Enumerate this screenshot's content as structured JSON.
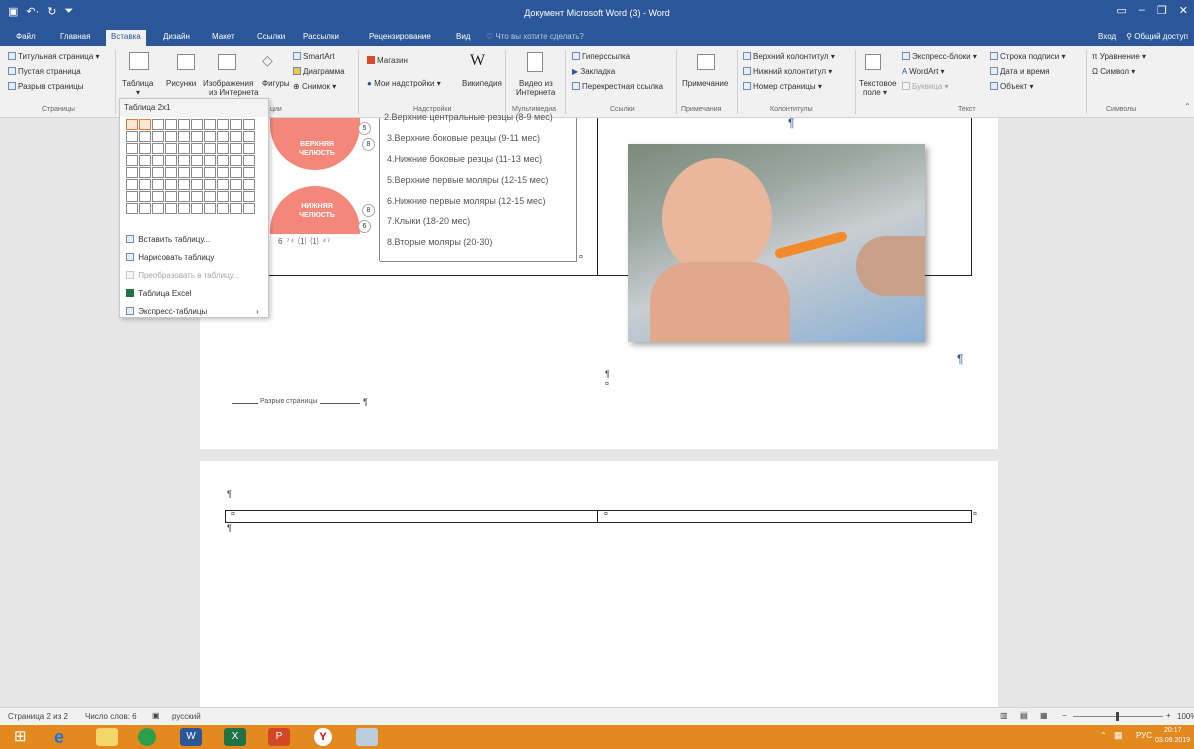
{
  "titlebar": {
    "title": "Документ Microsoft Word (3) - Word",
    "qat": [
      "save-icon",
      "undo-icon",
      "redo-icon",
      "customize-icon"
    ],
    "controls": [
      "ribbon-options-icon",
      "minimize-icon",
      "maximize-icon",
      "close-icon"
    ]
  },
  "tabs": [
    "Файл",
    "Главная",
    "Вставка",
    "Дизайн",
    "Макет",
    "Ссылки",
    "Рассылки",
    "Рецензирование",
    "Вид"
  ],
  "tell_me": "Что вы хотите сделать?",
  "signin": {
    "login": "Вход",
    "share": "Общий доступ"
  },
  "ribbon": {
    "pages": {
      "items": [
        "Титульная страница",
        "Пустая страница",
        "Разрыв страницы"
      ],
      "label": "Страницы"
    },
    "tables": {
      "table": "Таблица"
    },
    "illustrations": {
      "pictures": "Рисунки",
      "online_pictures_1": "Изображения",
      "online_pictures_2": "из Интернета",
      "shapes": "Фигуры",
      "smartart": "SmartArt",
      "chart": "Диаграмма",
      "screenshot": "Снимок",
      "label": "ции"
    },
    "addins": {
      "store": "Магазин",
      "my_addins": "Мои надстройки",
      "wikipedia": "Википедия",
      "label": "Надстройки"
    },
    "media": {
      "video1": "Видео из",
      "video2": "Интернета",
      "label": "Мультимедиа"
    },
    "links": {
      "hyperlink": "Гиперссылка",
      "bookmark": "Закладка",
      "crossref": "Перекрестная ссылка",
      "label": "Ссылки"
    },
    "comments": {
      "comment": "Примечание",
      "label": "Примечания"
    },
    "headerfooter": {
      "header": "Верхний колонтитул",
      "footer": "Нижний колонтитул",
      "pagenum": "Номер страницы",
      "label": "Колонтитулы"
    },
    "text": {
      "textbox1": "Текстовое",
      "textbox2": "поле",
      "express": "Экспресс-блоки",
      "wordart": "WordArt",
      "dropcap": "Буквица",
      "sigline": "Строка подписи",
      "datetime": "Дата и время",
      "object": "Объект",
      "label": "Текст"
    },
    "symbols": {
      "equation": "Уравнение",
      "symbol": "Символ",
      "label": "Символы"
    }
  },
  "dropdown": {
    "title": "Таблица 2x1",
    "selected_cols": 2,
    "selected_rows": 1,
    "items": [
      "Вставить таблицу...",
      "Нарисовать таблицу",
      "Преобразовать в таблицу...",
      "Таблица Excel",
      "Экспресс-таблицы"
    ]
  },
  "document": {
    "teeth_upper": "ВЕРХНЯЯ ЧЕЛЮСТЬ",
    "teeth_lower": "НИЖНЯЯ ЧЕЛЮСТЬ",
    "list": [
      "2.Верхние центральные резцы (8-9 мес)",
      "3.Верхние боковые резцы (9-11 мес)",
      "4.Нижние боковые резцы (11-13 мес)",
      "5.Верхние первые моляры (12-15 мес)",
      "6.Нижние первые моляры (12-15 мес)",
      "7.Клыки (18-20 мес)",
      "8.Вторые моляры (20-30)"
    ],
    "page_break": "Разрыв страницы",
    "para_mark": "¶",
    "cell_mark": "¤"
  },
  "status": {
    "page": "Страница 2 из 2",
    "words": "Число слов: 6",
    "lang": "русский",
    "zoom": "100%"
  },
  "taskbar": {
    "lang": "РУС",
    "time": "20:17",
    "date": "03.09.2019"
  },
  "colors": {
    "word_blue": "#2b579a",
    "taskbar": "#e28a1e",
    "selection": "#e07a3b"
  }
}
